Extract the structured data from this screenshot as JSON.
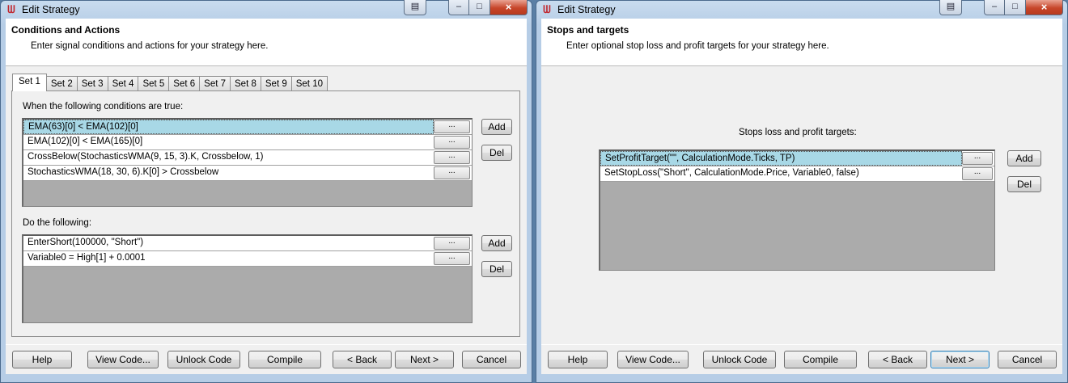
{
  "left": {
    "title": "Edit Strategy",
    "header_title": "Conditions and Actions",
    "header_sub": "Enter signal conditions and actions for your strategy here.",
    "tabs": [
      "Set 1",
      "Set 2",
      "Set 3",
      "Set 4",
      "Set 5",
      "Set 6",
      "Set 7",
      "Set 8",
      "Set 9",
      "Set 10"
    ],
    "conditions_label": "When the following conditions are true:",
    "conditions": [
      "EMA(63)[0] < EMA(102)[0]",
      "EMA(102)[0] < EMA(165)[0]",
      "CrossBelow(StochasticsWMA(9, 15, 3).K, Crossbelow, 1)",
      "StochasticsWMA(18, 30, 6).K[0] > Crossbelow"
    ],
    "actions_label": "Do the following:",
    "actions": [
      "EnterShort(100000, \"Short\")",
      "Variable0 = High[1] + 0.0001"
    ]
  },
  "right": {
    "title": "Edit Strategy",
    "header_title": "Stops and targets",
    "header_sub": "Enter optional stop loss and profit targets for your strategy here.",
    "targets_label": "Stops loss and profit targets:",
    "targets": [
      "SetProfitTarget(\"\", CalculationMode.Ticks, TP)",
      "SetStopLoss(\"Short\", CalculationMode.Price, Variable0, false)"
    ]
  },
  "common": {
    "ellipsis": "...",
    "add": "Add",
    "del": "Del",
    "help": "Help",
    "view_code": "View Code...",
    "unlock_code": "Unlock Code",
    "compile": "Compile",
    "back": "< Back",
    "next": "Next >",
    "cancel": "Cancel",
    "icon_app": "ninja-app-icon",
    "icon_close": "×",
    "icon_min": "–",
    "icon_max": "□",
    "icon_extra": "▤"
  },
  "colors": {
    "selected_row": "#a8d8e6",
    "title_bar": "#b6cde6",
    "close_button": "#c7462a"
  }
}
